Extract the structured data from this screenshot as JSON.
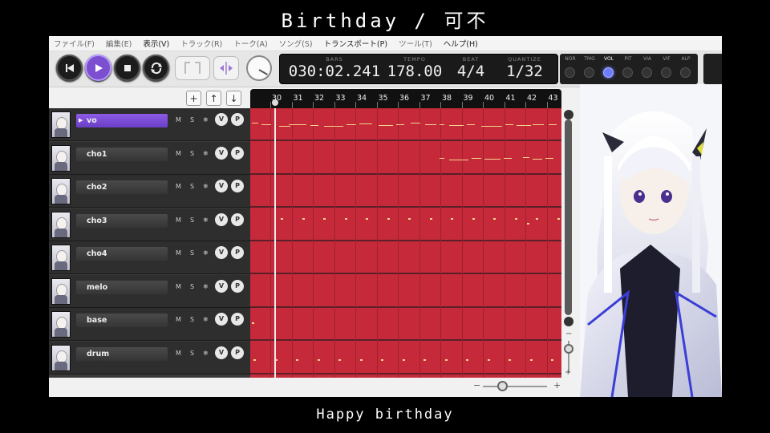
{
  "video": {
    "title": "Birthday / 可不",
    "caption": "Happy birthday"
  },
  "menu": [
    "ファイル(F)",
    "編集(E)",
    "表示(V)",
    "トラック(R)",
    "トーク(A)",
    "ソング(S)",
    "トランスポート(P)",
    "ツール(T)",
    "ヘルプ(H)"
  ],
  "lcd": {
    "bars_label": "BARS",
    "bars_value": "030:02.241",
    "tempo_label": "TEMPO",
    "tempo_value": "178.00",
    "beat_label": "BEAT",
    "beat_value": "4/4",
    "quantize_label": "QUANTIZE",
    "quantize_value": "1/32"
  },
  "params": [
    {
      "label": "NOR",
      "active": false
    },
    {
      "label": "TMG",
      "active": false
    },
    {
      "label": "VOL",
      "active": true
    },
    {
      "label": "PIT",
      "active": false
    },
    {
      "label": "VIA",
      "active": false
    },
    {
      "label": "VIF",
      "active": false
    },
    {
      "label": "ALP",
      "active": false
    }
  ],
  "track_toolbar": {
    "add": "+",
    "up": "↑",
    "down": "↓"
  },
  "track_buttons": {
    "mute": "M",
    "solo": "S",
    "freeze": "❄",
    "volume": "V",
    "pan": "P"
  },
  "tracks": [
    {
      "name": "vo",
      "selected": true
    },
    {
      "name": "cho1",
      "selected": false
    },
    {
      "name": "cho2",
      "selected": false
    },
    {
      "name": "cho3",
      "selected": false
    },
    {
      "name": "cho4",
      "selected": false
    },
    {
      "name": "melo",
      "selected": false
    },
    {
      "name": "base",
      "selected": false
    },
    {
      "name": "drum",
      "selected": false
    }
  ],
  "ruler": {
    "bars": [
      "30",
      "31",
      "32",
      "33",
      "34",
      "35",
      "36",
      "37",
      "38",
      "39",
      "40",
      "41",
      "42",
      "43"
    ]
  },
  "zoom": {
    "minus": "−",
    "plus": "+"
  },
  "colors": {
    "accent": "#7b4fd0",
    "grid": "#c62a3a",
    "note": "#f3d38a"
  }
}
